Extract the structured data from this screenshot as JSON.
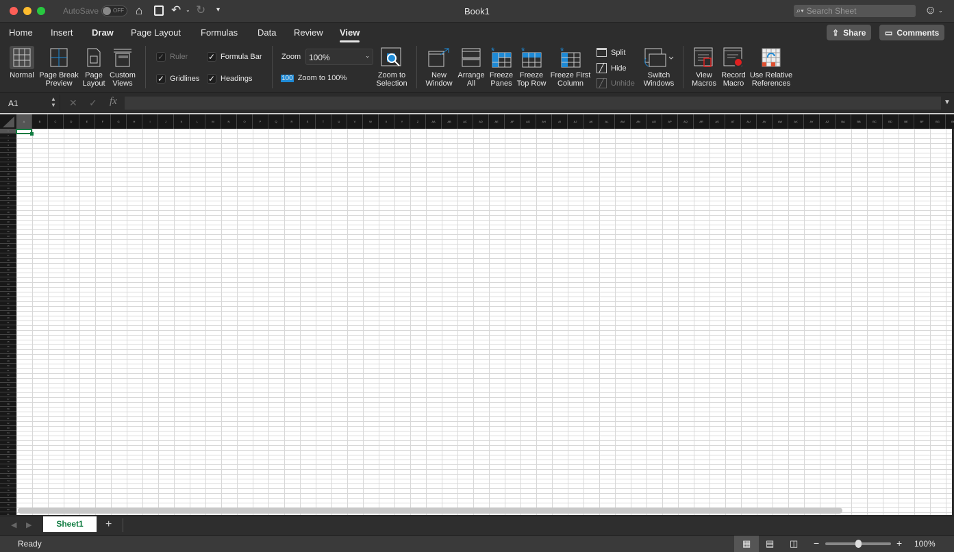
{
  "window": {
    "title": "Book1",
    "autosave_label": "AutoSave",
    "autosave_state": "OFF",
    "search_placeholder": "Search Sheet"
  },
  "tabs": [
    "Home",
    "Insert",
    "Draw",
    "Page Layout",
    "Formulas",
    "Data",
    "Review",
    "View"
  ],
  "active_tab": "View",
  "header_buttons": {
    "share": "Share",
    "comments": "Comments"
  },
  "ribbon": {
    "normal": "Normal",
    "page_break": [
      "Page Break",
      "Preview"
    ],
    "page_layout": [
      "Page",
      "Layout"
    ],
    "custom_views": [
      "Custom",
      "Views"
    ],
    "ruler": "Ruler",
    "formula_bar": "Formula Bar",
    "gridlines": "Gridlines",
    "headings": "Headings",
    "zoom_label": "Zoom",
    "zoom_value": "100%",
    "zoom_100_icon": "100",
    "zoom_100": "Zoom to 100%",
    "zoom_sel": [
      "Zoom to",
      "Selection"
    ],
    "new_window": [
      "New",
      "Window"
    ],
    "arrange_all": [
      "Arrange",
      "All"
    ],
    "freeze_panes": [
      "Freeze",
      "Panes"
    ],
    "freeze_top": [
      "Freeze",
      "Top Row"
    ],
    "freeze_first": [
      "Freeze First",
      "Column"
    ],
    "split": "Split",
    "hide": "Hide",
    "unhide": "Unhide",
    "switch_windows": [
      "Switch",
      "Windows"
    ],
    "view_macros": [
      "View",
      "Macros"
    ],
    "record_macro": [
      "Record",
      "Macro"
    ],
    "relative_refs": [
      "Use Relative",
      "References"
    ]
  },
  "formula": {
    "name_box": "A1",
    "fx": "fx",
    "value": ""
  },
  "sheets": [
    "Sheet1"
  ],
  "status": {
    "text": "Ready",
    "zoom": "100%",
    "zoom_fraction": 0.5
  },
  "colors": {
    "accent": "#107c41",
    "blue": "#1e8ad6"
  }
}
